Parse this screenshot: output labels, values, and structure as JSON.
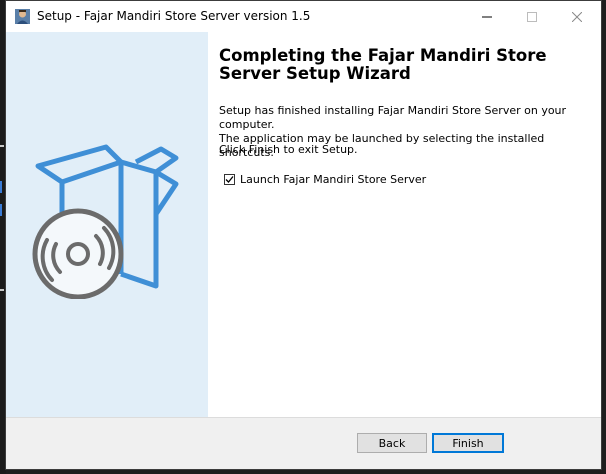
{
  "window": {
    "title": "Setup - Fajar Mandiri Store Server version 1.5",
    "app_icon": "setup-icon"
  },
  "titlebar_controls": {
    "minimize_icon": "minimize-icon",
    "maximize_icon": "maximize-icon",
    "close_icon": "close-icon"
  },
  "side_panel": {
    "illustration": "box-with-disc-icon",
    "background_color": "#e1eef8",
    "accent_color": "#3f8fd6"
  },
  "main": {
    "heading_line1": "Completing the Fajar Mandiri Store",
    "heading_line2": "Server Setup Wizard",
    "paragraph1_line1": "Setup has finished installing Fajar Mandiri Store Server on your computer.",
    "paragraph1_line2": "The application may be launched by selecting the installed shortcuts.",
    "paragraph2": "Click Finish to exit Setup.",
    "launch_checkbox": {
      "label": "Launch Fajar Mandiri Store Server",
      "checked": true
    }
  },
  "footer": {
    "back_label": "Back",
    "finish_label": "Finish"
  }
}
